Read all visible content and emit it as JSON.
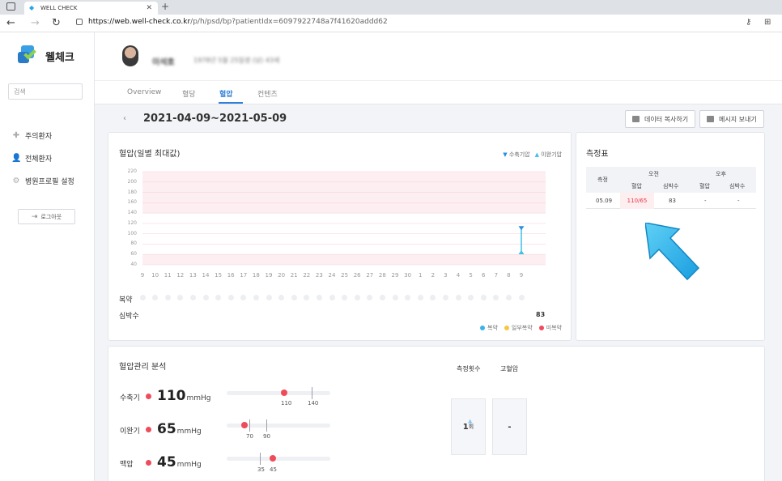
{
  "browser": {
    "tab_title": "WELL CHECK",
    "url_host": "https://web.well-check.co.kr",
    "url_path": "/p/h/psd/bp?patientIdx=6097922748a7f41620addd62"
  },
  "sidebar": {
    "logo_text": "웰체크",
    "search_placeholder": "검색",
    "items": [
      {
        "label": "주의환자",
        "icon": "plus-icon"
      },
      {
        "label": "전체환자",
        "icon": "user-add-icon"
      },
      {
        "label": "병원프로필 설정",
        "icon": "gear-icon"
      }
    ],
    "logout_label": "로그아웃"
  },
  "patient": {
    "name": "이석호",
    "info": "1978년 5월 25일생 (남) 43세"
  },
  "tabs": [
    "Overview",
    "혈당",
    "혈압",
    "컨텐츠"
  ],
  "active_tab": "혈압",
  "date_range": "2021-04-09~2021-05-09",
  "buttons": {
    "copy_data": "데이터 복사하기",
    "send_message": "메시지 보내기"
  },
  "chart_panel": {
    "title": "혈압(일별 최대값)",
    "legend_systolic": "수축기압",
    "legend_diastolic": "이완기압",
    "row_med": "복약",
    "row_hr": "심박수",
    "hr_value": "83",
    "legend_bottom": [
      "복약",
      "일부복약",
      "미복약"
    ],
    "legend_colors": [
      "#3bb3e6",
      "#f5c842",
      "#ee4b5b"
    ]
  },
  "chart_data": {
    "type": "line",
    "title": "혈압(일별 최대값)",
    "x": [
      "9",
      "10",
      "11",
      "12",
      "13",
      "14",
      "15",
      "16",
      "17",
      "18",
      "19",
      "20",
      "21",
      "22",
      "23",
      "24",
      "25",
      "26",
      "27",
      "28",
      "29",
      "30",
      "1",
      "2",
      "3",
      "4",
      "5",
      "6",
      "7",
      "8",
      "9"
    ],
    "y_ticks": [
      "220",
      "200",
      "180",
      "160",
      "140",
      "120",
      "100",
      "80",
      "60",
      "40"
    ],
    "ylim": [
      40,
      220
    ],
    "series": [
      {
        "name": "수축기압",
        "points": [
          {
            "x": "9",
            "y": 110
          }
        ]
      },
      {
        "name": "이완기압",
        "points": [
          {
            "x": "9",
            "y": 65
          }
        ]
      }
    ],
    "bands": [
      [
        140,
        220
      ],
      [
        40,
        60
      ]
    ]
  },
  "measure_table": {
    "title": "측정표",
    "col_measure": "측정",
    "am": "오전",
    "pm": "오후",
    "sub_bp": "혈압",
    "sub_hr": "심박수",
    "rows": [
      {
        "date": "05.09",
        "am_bp": "110/65",
        "am_hr": "83",
        "pm_bp": "-",
        "pm_hr": "-"
      }
    ]
  },
  "analysis": {
    "title": "혈압관리 분석",
    "systolic": {
      "label": "수축기",
      "value": "110",
      "unit": "mmHg",
      "ticks": [
        "110",
        "140"
      ]
    },
    "diastolic": {
      "label": "이완기",
      "value": "65",
      "unit": "mmHg",
      "ticks": [
        "70",
        "90"
      ]
    },
    "pulse": {
      "label": "맥압",
      "value": "45",
      "unit": "mmHg",
      "ticks": [
        "35",
        "45"
      ]
    },
    "count_header": "측정횟수",
    "hypertension_header": "고혈압",
    "count_value": "1",
    "count_unit": "회",
    "hypertension_value": "-"
  }
}
